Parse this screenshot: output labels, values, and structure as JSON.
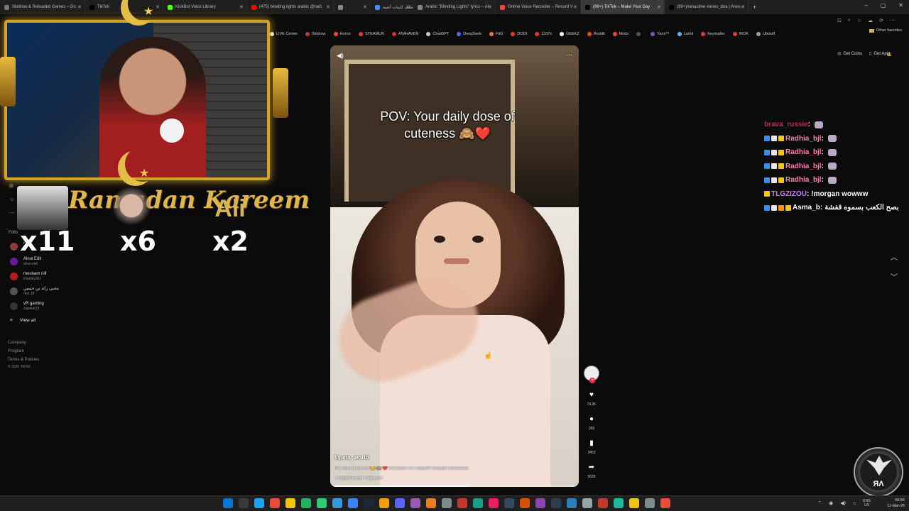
{
  "browser": {
    "tabs": [
      {
        "label": "Skidrow & Reloaded Games – Do",
        "color": "#777777",
        "width": 120
      },
      {
        "label": "TikTok",
        "color": "#000000",
        "width": 110
      },
      {
        "label": "KickBot Voice Library",
        "color": "#53fc18",
        "width": 118
      },
      {
        "label": "(475) blinding lights arabic @radi",
        "color": "#ff0000",
        "width": 122
      },
      {
        "label": "",
        "color": "#888888",
        "width": 52
      },
      {
        "label": "طلب كلمات أغنية",
        "color": "#4a8af4",
        "width": 60
      },
      {
        "label": "Arabic \"Blinding Lights\" lyrics – AI",
        "color": "#888888",
        "width": 116
      },
      {
        "label": "Online Voice Recorder – Record V",
        "color": "#e44",
        "width": 120
      },
      {
        "label": "(99+) TikTok – Make Your Day",
        "color": "#000000",
        "width": 118,
        "active": true
      },
      {
        "label": "(99+)#anastine #anes_dna | Anes",
        "color": "#000000",
        "width": 118
      }
    ],
    "new_tab": "+",
    "window_controls": [
      "–",
      "▢",
      "✕"
    ],
    "address_icons": [
      "⊡",
      "⌕",
      "☆",
      "☁",
      "⟳",
      "⋯"
    ]
  },
  "bookmarks": {
    "items": [
      {
        "label": "LIVE Center",
        "color": "#ffffff"
      },
      {
        "label": "Skidrow",
        "color": "#c0392b"
      },
      {
        "label": "Horror",
        "color": "#e74c3c"
      },
      {
        "label": "STEAMUN",
        "color": "#e53935"
      },
      {
        "label": "A!MHAVEN",
        "color": "#d32f2f"
      },
      {
        "label": "ChatGPT",
        "color": "#cccccc"
      },
      {
        "label": "DeepSeek",
        "color": "#4d6bfe"
      },
      {
        "label": "FitG",
        "color": "#ff7043"
      },
      {
        "label": "DODI",
        "color": "#e53935"
      },
      {
        "label": "1337x",
        "color": "#e53935"
      },
      {
        "label": "GEEKZ",
        "color": "#ffffff"
      },
      {
        "label": "Reddit",
        "color": "#ff4500"
      },
      {
        "label": "Mods",
        "color": "#f44336"
      },
      {
        "label": "",
        "color": "#555555"
      },
      {
        "label": "Yami™",
        "color": "#7e57c2"
      },
      {
        "label": "Larkit",
        "color": "#64b5f6"
      },
      {
        "label": "Keymailer",
        "color": "#e53935"
      },
      {
        "label": "IROK",
        "color": "#e53935"
      },
      {
        "label": "Ubisoft",
        "color": "#9e9e9e"
      }
    ],
    "other": "Other favorites"
  },
  "overlay": {
    "ramadan_text": "Ramadan Kareem",
    "counters": [
      "x11",
      "x6",
      "x2"
    ],
    "watermark_name": "Ali",
    "logo_text": "ЯΛ"
  },
  "sidebar": {
    "following_label": "Follo",
    "following": [
      {
        "name": "Nida",
        "user": "",
        "color": "#8e3b3b"
      },
      {
        "name": "Aloui Edit",
        "user": "aloui.edit",
        "color": "#6a1b9a"
      },
      {
        "name": "mounam nill",
        "user": "insanitydzz",
        "color": "#b71c1c"
      },
      {
        "name": "محبي رائد بن حسين",
        "user": "rhct.1ff",
        "color": "#555555"
      },
      {
        "name": "vR gaming",
        "user": "vrgame19",
        "color": "#333333"
      }
    ],
    "view_all": "View all",
    "footer": [
      "Company",
      "Program",
      "Terms & Policies",
      "© 2026 TikTok"
    ]
  },
  "video": {
    "caption_line1": "POV: Your daily dose of",
    "caption_line2": "cuteness 🙈❤️",
    "author": "liyana_world",
    "description": "Her smile at the end 🥺 🙈 ❤️ #cutebaby #uk #babylife #babygirl #babytiktok",
    "sound": "♫  original sound - http.poon",
    "progress": 0.55
  },
  "actions": {
    "likes": "74.9K",
    "comments": "359",
    "saves": "3453",
    "shares": "5628"
  },
  "tiktok_top": {
    "get_coins": "Get Coins",
    "get_app": "Get App"
  },
  "chat": [
    {
      "user": "brava_russie",
      "color": "#d81b60",
      "msg": "",
      "badges": []
    },
    {
      "user": "Radhia_bjl",
      "color": "#ff7eb6",
      "msg": "",
      "badges": [
        "#3b8df0",
        "#e6e6e6",
        "#f5c518"
      ]
    },
    {
      "user": "Radhia_bjl",
      "color": "#ff7eb6",
      "msg": "",
      "badges": [
        "#3b8df0",
        "#e6e6e6",
        "#f5c518"
      ]
    },
    {
      "user": "Radhia_bjl",
      "color": "#ff7eb6",
      "msg": "",
      "badges": [
        "#3b8df0",
        "#e6e6e6",
        "#f5c518"
      ]
    },
    {
      "user": "Radhia_bjl",
      "color": "#ff7eb6",
      "msg": "",
      "badges": [
        "#3b8df0",
        "#e6e6e6",
        "#f5c518"
      ]
    },
    {
      "user": "TLGZIZOU",
      "color": "#c77dff",
      "msg": "!morgan wowww",
      "badges": [
        "#f5c518"
      ]
    },
    {
      "user": "Asma_b",
      "color": "#ffffff",
      "msg": "بصح الكعب بسموه قفشة",
      "badges": [
        "#3b8df0",
        "#e6e6e6",
        "#ff9800",
        "#f5c518"
      ]
    }
  ],
  "taskbar": {
    "icons": [
      "#0078d4",
      "#3a3a3a",
      "#1da1f2",
      "#e74c3c",
      "#f1c40f",
      "#27ae60",
      "#2ecc71",
      "#3498db",
      "#3b82f6",
      "#1b2838",
      "#f39c12",
      "#5865f2",
      "#9b59b6",
      "#e67e22",
      "#7f8c8d",
      "#c0392b",
      "#16a085",
      "#e91e63",
      "#34495e",
      "#d35400",
      "#8e44ad",
      "#2c3e50",
      "#2980b9",
      "#95a5a6",
      "#c0392b",
      "#1abc9c",
      "#f1c40f",
      "#7f8c8d",
      "#e74c3c"
    ],
    "lang1": "ENG",
    "lang2": "US",
    "time": "00:56",
    "date": "11-Mar-26"
  }
}
